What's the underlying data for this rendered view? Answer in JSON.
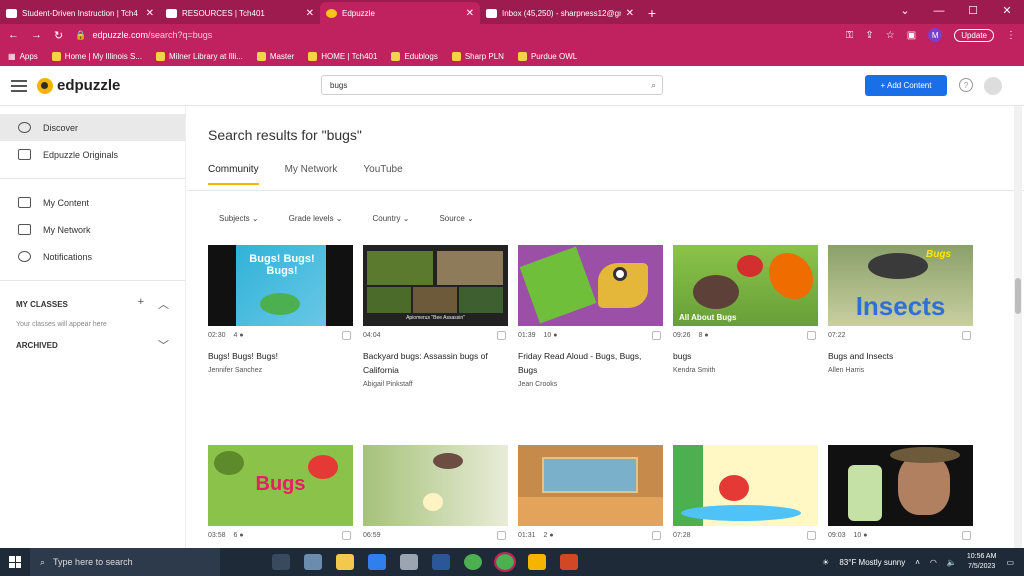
{
  "browser": {
    "tabs": [
      {
        "label": "Student-Driven Instruction | Tch4",
        "icon": "page-icon"
      },
      {
        "label": "RESOURCES | Tch401",
        "icon": "page-icon"
      },
      {
        "label": "Edpuzzle",
        "icon": "edpuzzle-icon",
        "active": true
      },
      {
        "label": "Inbox (45,250) - sharpness12@gm",
        "icon": "gmail-icon"
      }
    ],
    "url_host": "edpuzzle.com",
    "url_path": "/search?q=bugs",
    "profile_letter": "M",
    "update_label": "Update",
    "bookmarks": [
      "Apps",
      "Home | My Illinois S...",
      "Milner Library at Illi...",
      "Master",
      "HOME | Tch401",
      "Edublogs",
      "Sharp PLN",
      "Purdue OWL"
    ]
  },
  "header": {
    "logo_text": "edpuzzle",
    "search_value": "bugs",
    "add_content_label": "+ Add Content"
  },
  "sidebar": {
    "items": [
      {
        "label": "Discover",
        "icon": "compass-icon",
        "active": true
      },
      {
        "label": "Edpuzzle Originals",
        "icon": "film-icon"
      },
      {
        "label": "My Content",
        "icon": "folder-icon"
      },
      {
        "label": "My Network",
        "icon": "building-icon"
      },
      {
        "label": "Notifications",
        "icon": "bell-icon"
      }
    ],
    "my_classes_label": "MY CLASSES",
    "classes_note": "Your classes will appear here",
    "archived_label": "ARCHIVED"
  },
  "main": {
    "results_title": "Search results for \"bugs\"",
    "tabs": [
      "Community",
      "My Network",
      "YouTube"
    ],
    "filters": [
      "Subjects",
      "Grade levels",
      "Country",
      "Source"
    ],
    "cards": [
      {
        "duration": "02:30",
        "questions": "4",
        "title": "Bugs! Bugs! Bugs!",
        "author": "Jennifer Sanchez",
        "thumb_text": "Bugs! Bugs! Bugs!"
      },
      {
        "duration": "04:04",
        "questions": "",
        "title": "Backyard bugs: Assassin bugs of California",
        "author": "Abigail Pinkstaff",
        "thumb_text": "Apiomerus \"Bee Assassin\""
      },
      {
        "duration": "01:39",
        "questions": "10",
        "title": "Friday Read Aloud - Bugs, Bugs, Bugs",
        "author": "Jean Crooks",
        "thumb_text": ""
      },
      {
        "duration": "09:26",
        "questions": "8",
        "title": "bugs",
        "author": "Kendra Smith",
        "thumb_text": "All About Bugs"
      },
      {
        "duration": "07:22",
        "questions": "",
        "title": "Bugs and Insects",
        "author": "Allen Harris",
        "thumb_text": "Insects"
      },
      {
        "duration": "03:58",
        "questions": "6",
        "title": "",
        "author": "",
        "thumb_text": "Bugs"
      },
      {
        "duration": "06:59",
        "questions": "",
        "title": "",
        "author": "",
        "thumb_text": ""
      },
      {
        "duration": "01:31",
        "questions": "2",
        "title": "",
        "author": "",
        "thumb_text": ""
      },
      {
        "duration": "07:28",
        "questions": "",
        "title": "",
        "author": "",
        "thumb_text": ""
      },
      {
        "duration": "09:03",
        "questions": "10",
        "title": "",
        "author": "",
        "thumb_text": ""
      }
    ]
  },
  "taskbar": {
    "search_placeholder": "Type here to search",
    "weather": "83°F Mostly sunny",
    "time": "10:56 AM",
    "date": "7/5/2023"
  },
  "colors": {
    "browser_frame": "#c0225f",
    "accent_blue": "#1a6fe8",
    "edpuzzle_yellow": "#f5b400"
  }
}
